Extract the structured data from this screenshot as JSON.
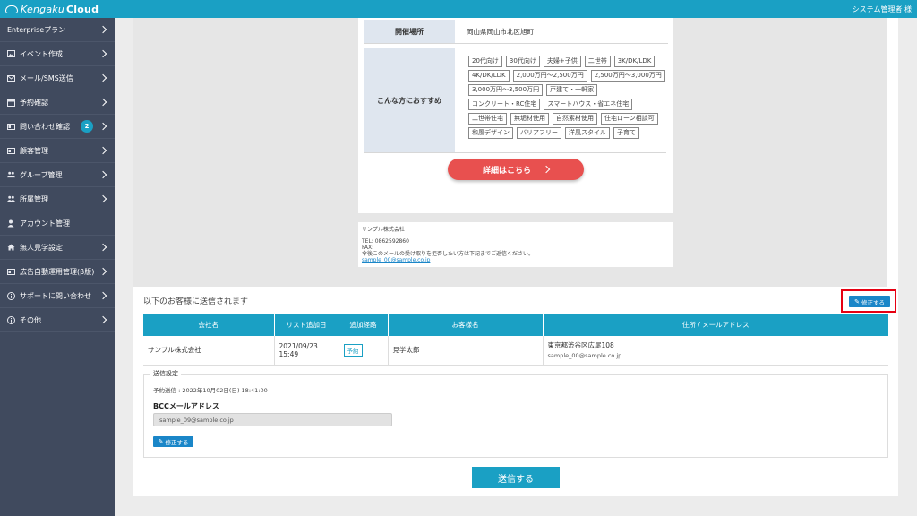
{
  "header": {
    "logo_text_1": "Kengaku",
    "logo_text_2": "Cloud",
    "user_label": "システム管理者 様"
  },
  "sidebar": {
    "items": [
      {
        "label": "Enterpriseプラン",
        "icon": "none"
      },
      {
        "label": "イベント作成",
        "icon": "image-icon"
      },
      {
        "label": "メール/SMS送信",
        "icon": "mail-icon"
      },
      {
        "label": "予約確認",
        "icon": "calendar-icon"
      },
      {
        "label": "問い合わせ確認",
        "icon": "id-card-icon",
        "badge": "2"
      },
      {
        "label": "顧客管理",
        "icon": "id-card-icon"
      },
      {
        "label": "グループ管理",
        "icon": "users-icon"
      },
      {
        "label": "所属管理",
        "icon": "users-icon"
      },
      {
        "label": "アカウント管理",
        "icon": "user-icon"
      },
      {
        "label": "無人見学設定",
        "icon": "home-icon"
      },
      {
        "label": "広告自動運用管理(β版)",
        "icon": "id-card-icon"
      },
      {
        "label": "サポートに問い合わせ",
        "icon": "info-icon"
      },
      {
        "label": "その他",
        "icon": "info-icon"
      }
    ]
  },
  "preview": {
    "location_label": "開催場所",
    "location_value": "岡山県岡山市北区旭町",
    "recommend_label": "こんな方におすすめ",
    "tags": [
      "20代向け",
      "30代向け",
      "夫婦+子供",
      "二世帯",
      "3K/DK/LDK",
      "4K/DK/LDK",
      "2,000万円〜2,500万円",
      "2,500万円〜3,000万円",
      "3,000万円〜3,500万円",
      "戸建て・一軒家",
      "コンクリート・RC住宅",
      "スマートハウス・省エネ住宅",
      "二世帯住宅",
      "無垢材使用",
      "自然素材使用",
      "住宅ローン相談可",
      "和風デザイン",
      "バリアフリー",
      "洋風スタイル",
      "子育て"
    ],
    "detail_button": "詳細はこちら",
    "footer_company": "サンプル株式会社",
    "footer_tel": "TEL: 0862592860",
    "footer_fax": "FAX:",
    "footer_note": "今後このメールの受け取りを拒否したい方は下記までご返信ください。",
    "footer_email": "sample_00@sample.co.jp"
  },
  "recipients": {
    "heading": "以下のお客様に送信されます",
    "edit_button": "修正する",
    "columns": [
      "会社名",
      "リスト追加日",
      "追加経路",
      "お客様名",
      "住所 / メールアドレス"
    ],
    "rows": [
      {
        "company": "サンプル株式会社",
        "date_1": "2021/09/23",
        "date_2": "15:49",
        "route": "予約",
        "customer": "見学太郎",
        "address": "東京都渋谷区広尾108",
        "email": "sample_00@sample.co.jp"
      }
    ]
  },
  "settings": {
    "legend": "送信設定",
    "scheduled": "予約送信 : 2022年10月02日(日) 18:41:00",
    "bcc_label": "BCCメールアドレス",
    "bcc_value": "sample_09@sample.co.jp",
    "edit_button": "修正する"
  },
  "submit_button": "送信する",
  "colors": {
    "accent": "#1aa0c4",
    "sidebar": "#404a5e",
    "cta": "#e8504f",
    "highlight": "#e60012"
  }
}
